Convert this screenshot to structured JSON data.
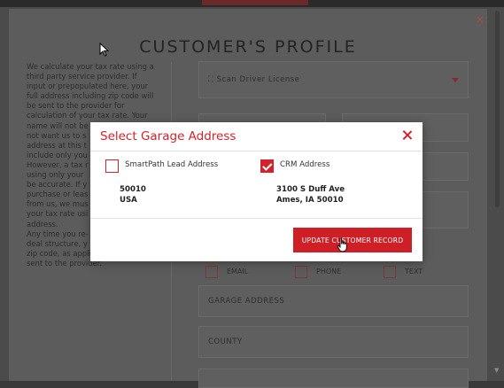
{
  "profile": {
    "title": "CUSTOMER'S PROFILE",
    "close_symbol": "×",
    "tax_text": "We calculate your tax rate using a\nthird party service provider. If\ninput or prepopulated here, your\nfull address including zip code will\nbe sent to the provider for\ncalculation of your tax rate. Your\nname will not be\nnot want us to s\naddress at this t\ninclude only you\nHowever, a tax r\nusing only your\nbe accurate. If y\npurchase or leas\nfrom us, we mus\nyour tax rate usi\naddress.\nAny time you re-\ndeal structure, y\nzip code, as applicable, will be re-\nsent to the provider.",
    "scan_license_label": "Scan Driver License",
    "contact_options": [
      "EMAIL",
      "PHONE",
      "TEXT"
    ],
    "garage_address_label": "GARAGE ADDRESS",
    "county_label": "COUNTY"
  },
  "modal": {
    "title": "Select Garage Address",
    "options": [
      {
        "label": "SmartPath Lead Address",
        "checked": false,
        "line1": "50010",
        "line2": "USA"
      },
      {
        "label": "CRM Address",
        "checked": true,
        "line1": "3100 S Duff Ave",
        "line2": "Ames, IA 50010"
      }
    ],
    "update_button": "UPDATE CUSTOMER RECORD"
  },
  "colors": {
    "accent": "#d3232a",
    "overlay": "#4b4b4b"
  },
  "icons": {
    "scan": "scan-frame-icon",
    "close": "close-icon",
    "dropdown": "chevron-down-icon",
    "check": "check-icon"
  }
}
